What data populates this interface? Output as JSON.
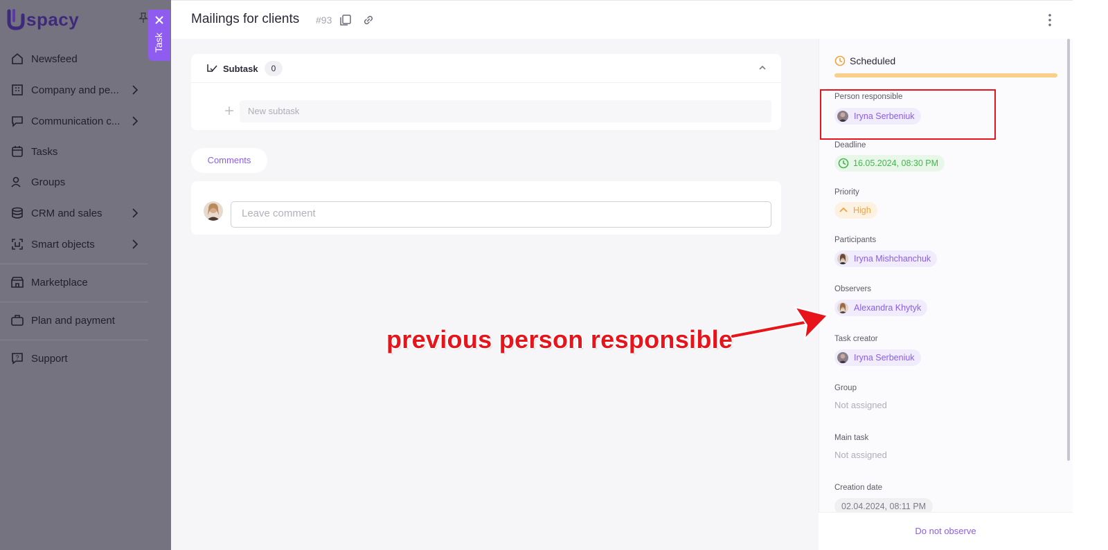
{
  "app": {
    "logo_text": "spacy"
  },
  "sidebar": {
    "items": [
      {
        "label": "Newsfeed",
        "icon": "home-icon"
      },
      {
        "label": "Company and pe...",
        "icon": "building-icon",
        "has_submenu": true
      },
      {
        "label": "Communication c...",
        "icon": "chat-icon",
        "has_submenu": true
      },
      {
        "label": "Tasks",
        "icon": "calendar-icon"
      },
      {
        "label": "Groups",
        "icon": "users-icon"
      },
      {
        "label": "CRM and sales",
        "icon": "database-icon",
        "has_submenu": true
      },
      {
        "label": "Smart objects",
        "icon": "scan-icon",
        "has_submenu": true
      },
      {
        "label": "Marketplace",
        "icon": "store-icon"
      },
      {
        "label": "Plan and payment",
        "icon": "briefcase-icon"
      },
      {
        "label": "Support",
        "icon": "help-icon"
      }
    ]
  },
  "task_tab": {
    "label": "Task"
  },
  "header": {
    "title": "Mailings for clients",
    "task_number": "#93"
  },
  "subtask": {
    "title": "Subtask",
    "count": "0",
    "new_placeholder": "New subtask"
  },
  "comments": {
    "tab_label": "Comments",
    "placeholder": "Leave comment"
  },
  "details": {
    "status": "Scheduled",
    "person_responsible": {
      "label": "Person responsible",
      "name": "Iryna Serbeniuk"
    },
    "deadline": {
      "label": "Deadline",
      "value": "16.05.2024, 08:30 PM"
    },
    "priority": {
      "label": "Priority",
      "value": "High"
    },
    "participants": {
      "label": "Participants",
      "name": "Iryna Mishchanchuk"
    },
    "observers": {
      "label": "Observers",
      "name": "Alexandra Khytyk"
    },
    "task_creator": {
      "label": "Task creator",
      "name": "Iryna Serbeniuk"
    },
    "group": {
      "label": "Group",
      "value": "Not assigned"
    },
    "main_task": {
      "label": "Main task",
      "value": "Not assigned"
    },
    "creation_date": {
      "label": "Creation date",
      "value": "02.04.2024, 08:11 PM"
    },
    "footer_button": "Do not observe"
  },
  "annotation": {
    "text": "previous person responsible"
  },
  "colors": {
    "accent": "#8a5cf0",
    "status_scheduled": "#f9d08a",
    "deadline_green": "#41b84a",
    "priority_orange": "#f2a338",
    "annotation_red": "#e8141c"
  }
}
